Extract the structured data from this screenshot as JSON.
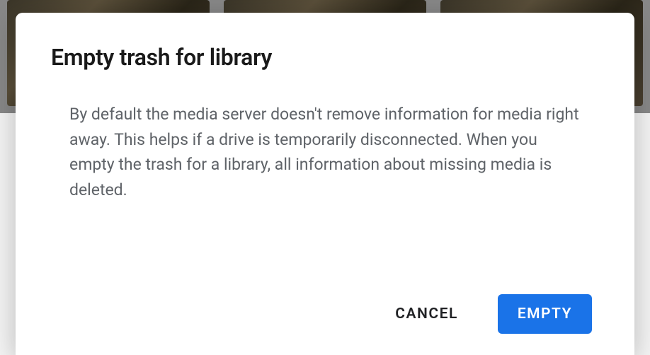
{
  "dialog": {
    "title": "Empty trash for library",
    "body": "By default the media server doesn't remove information for media right away. This helps if a drive is temporarily disconnected. When you empty the trash for a library, all information about missing media is deleted.",
    "actions": {
      "cancel": "CANCEL",
      "confirm": "EMPTY"
    }
  }
}
